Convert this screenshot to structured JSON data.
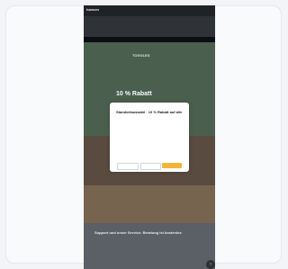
{
  "page": {
    "logo": "hansen",
    "nav": "",
    "strip_text": "",
    "hero_label": "TOGGLES",
    "hero_title": "10 % Rabatt",
    "hero_sub": "",
    "hero_dots": "•••",
    "feature1_title": "",
    "feature2_title": "",
    "footer_title": "Support und unser Service: Beratung ist kostenlos",
    "footer_left": "",
    "footer_right": "",
    "fab_icon": "↑"
  },
  "modal": {
    "title": "Standortauswahl · 10 % Rabatt auf alle",
    "body": "",
    "link": "",
    "btn_one": "",
    "btn_two": "",
    "btn_three": ""
  }
}
